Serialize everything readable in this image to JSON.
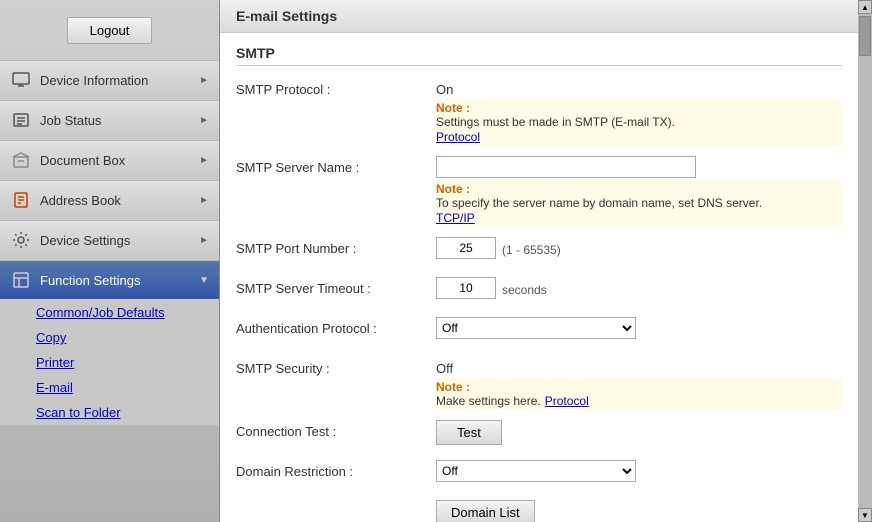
{
  "sidebar": {
    "logout_label": "Logout",
    "items": [
      {
        "id": "device-information",
        "label": "Device Information",
        "icon": "monitor",
        "active": false,
        "has_arrow": true
      },
      {
        "id": "job-status",
        "label": "Job Status",
        "icon": "list",
        "active": false,
        "has_arrow": true
      },
      {
        "id": "document-box",
        "label": "Document Box",
        "icon": "box",
        "active": false,
        "has_arrow": true
      },
      {
        "id": "address-book",
        "label": "Address Book",
        "icon": "book",
        "active": false,
        "has_arrow": true
      },
      {
        "id": "device-settings",
        "label": "Device Settings",
        "icon": "settings",
        "active": false,
        "has_arrow": true
      },
      {
        "id": "function-settings",
        "label": "Function Settings",
        "icon": "function",
        "active": true,
        "has_arrow": true
      }
    ],
    "submenu": [
      {
        "id": "common-job-defaults",
        "label": "Common/Job Defaults"
      },
      {
        "id": "copy",
        "label": "Copy"
      },
      {
        "id": "printer",
        "label": "Printer"
      },
      {
        "id": "email",
        "label": "E-mail"
      },
      {
        "id": "scan-to-folder",
        "label": "Scan to Folder"
      }
    ]
  },
  "page": {
    "title": "E-mail Settings",
    "section": "SMTP",
    "fields": {
      "smtp_protocol_label": "SMTP Protocol :",
      "smtp_protocol_value": "On",
      "note1_label": "Note :",
      "note1_text": "Settings must be made in SMTP (E-mail TX).",
      "note1_link": "Protocol",
      "smtp_server_name_label": "SMTP Server Name :",
      "smtp_server_name_value": "",
      "note2_label": "Note :",
      "note2_text": "To specify the server name by domain name, set DNS server.",
      "note2_link": "TCP/IP",
      "smtp_port_number_label": "SMTP Port Number :",
      "smtp_port_number_value": "25",
      "smtp_port_range": "(1 - 65535)",
      "smtp_server_timeout_label": "SMTP Server Timeout :",
      "smtp_server_timeout_value": "10",
      "smtp_server_timeout_unit": "seconds",
      "authentication_protocol_label": "Authentication Protocol :",
      "authentication_protocol_value": "Off",
      "smtp_security_label": "SMTP Security :",
      "smtp_security_value": "Off",
      "note3_label": "Note :",
      "note3_text": "Make settings here.",
      "note3_link": "Protocol",
      "connection_test_label": "Connection Test :",
      "connection_test_btn": "Test",
      "domain_restriction_label": "Domain Restriction :",
      "domain_restriction_value": "Off",
      "domain_list_btn": "Domain List"
    }
  }
}
